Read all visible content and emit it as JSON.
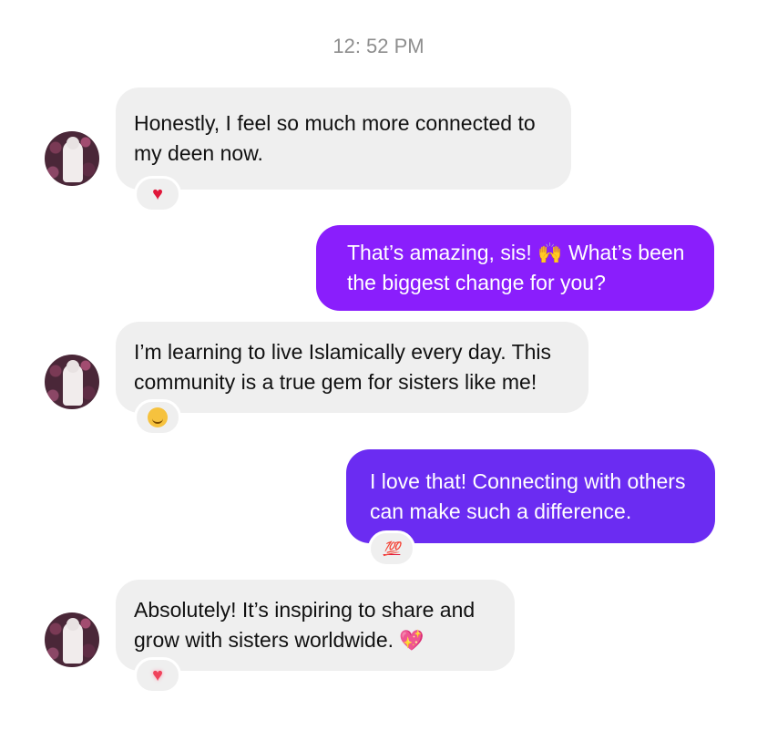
{
  "timestamp": "12: 52 PM",
  "messages": [
    {
      "direction": "incoming",
      "text": "Honestly, I feel so much more connected to my deen now.",
      "reaction": "heart-icon"
    },
    {
      "direction": "outgoing",
      "text_before": "That’s amazing, sis!",
      "emoji": "🙌",
      "text_after": "What’s been the biggest change for you?"
    },
    {
      "direction": "incoming",
      "text": "I’m learning to live Islamically every day. This community is a true gem for sisters like me!",
      "reaction": "smiling-face-with-hearts-icon"
    },
    {
      "direction": "outgoing",
      "text": "I love that! Connecting with others can make such a difference.",
      "reaction_text": "💯"
    },
    {
      "direction": "incoming",
      "text": "Absolutely! It’s inspiring to share and grow with sisters worldwide.",
      "emoji": "💖",
      "reaction": "heart-icon"
    }
  ],
  "colors": {
    "incoming_bubble": "#efefef",
    "outgoing_bubble_1": "#8a1efc",
    "outgoing_bubble_2": "#6b2cf2",
    "timestamp": "#8e8e8e",
    "heart": "#e0173a"
  }
}
